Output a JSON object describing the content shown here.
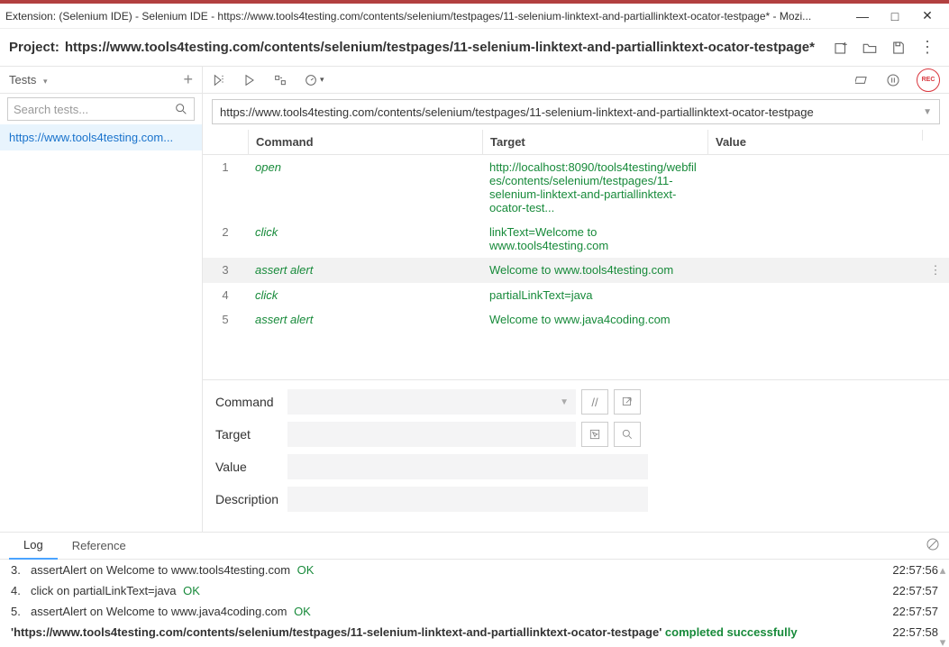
{
  "window": {
    "title": "Extension: (Selenium IDE) - Selenium IDE - https://www.tools4testing.com/contents/selenium/testpages/11-selenium-linktext-and-partiallinktext-ocator-testpage* - Mozi..."
  },
  "project": {
    "label": "Project:",
    "name": "https://www.tools4testing.com/contents/selenium/testpages/11-selenium-linktext-and-partiallinktext-ocator-testpage*"
  },
  "sidebar": {
    "tests_label": "Tests",
    "plus": "+",
    "search_placeholder": "Search tests...",
    "items": [
      {
        "label": "https://www.tools4testing.com..."
      }
    ]
  },
  "urlbar": {
    "value": "https://www.tools4testing.com/contents/selenium/testpages/11-selenium-linktext-and-partiallinktext-ocator-testpage"
  },
  "columns": {
    "command": "Command",
    "target": "Target",
    "value": "Value"
  },
  "rows": [
    {
      "n": "1",
      "command": "open",
      "target": "http://localhost:8090/tools4testing/webfiles/contents/selenium/testpages/11-selenium-linktext-and-partiallinktext-ocator-test...",
      "value": "",
      "selected": false
    },
    {
      "n": "2",
      "command": "click",
      "target": "linkText=Welcome to www.tools4testing.com",
      "value": "",
      "selected": false
    },
    {
      "n": "3",
      "command": "assert alert",
      "target": "Welcome to www.tools4testing.com",
      "value": "",
      "selected": true
    },
    {
      "n": "4",
      "command": "click",
      "target": "partialLinkText=java",
      "value": "",
      "selected": false
    },
    {
      "n": "5",
      "command": "assert alert",
      "target": "Welcome to www.java4coding.com",
      "value": "",
      "selected": false
    }
  ],
  "editor": {
    "command_label": "Command",
    "target_label": "Target",
    "value_label": "Value",
    "description_label": "Description",
    "slashes": "//"
  },
  "log": {
    "tab_log": "Log",
    "tab_ref": "Reference",
    "lines": [
      {
        "n": "3.",
        "text": "assertAlert on Welcome to www.tools4testing.com",
        "status": "OK",
        "time": "22:57:56"
      },
      {
        "n": "4.",
        "text": "click on partialLinkText=java",
        "status": "OK",
        "time": "22:57:57"
      },
      {
        "n": "5.",
        "text": "assertAlert on Welcome to www.java4coding.com",
        "status": "OK",
        "time": "22:57:57"
      }
    ],
    "done": {
      "url": "'https://www.tools4testing.com/contents/selenium/testpages/11-selenium-linktext-and-partiallinktext-ocator-testpage'",
      "status": " completed successfully",
      "time": "22:57:58"
    }
  }
}
